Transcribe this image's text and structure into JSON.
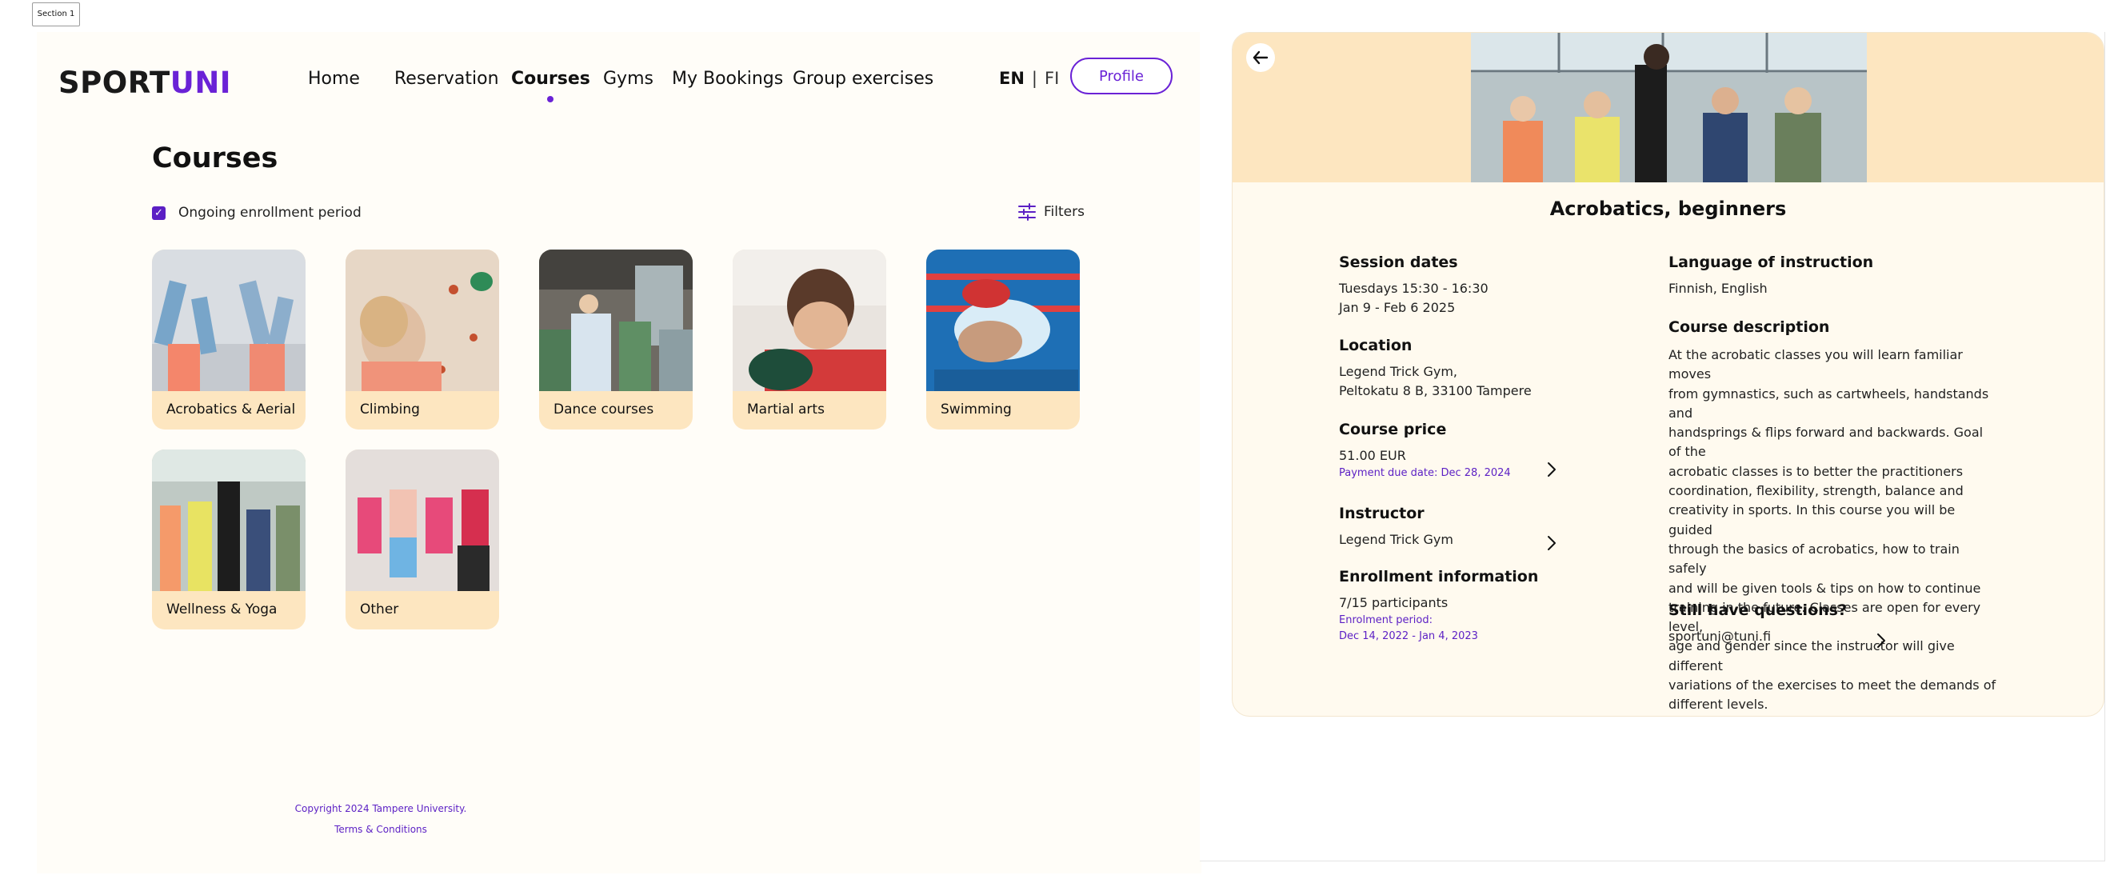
{
  "section_tag": "Section 1",
  "brand": {
    "part1": "SPORT",
    "part2": "UNI",
    "accent": "#6a22d6"
  },
  "nav": {
    "items": [
      "Home",
      "Reservation",
      "Courses",
      "Gyms",
      "My Bookings",
      "Group exercises"
    ],
    "active": "Courses"
  },
  "lang": {
    "en": "EN",
    "sep": "|",
    "fi": "FI"
  },
  "profile_label": "Profile",
  "page_title": "Courses",
  "enrollment_filter": {
    "label": "Ongoing enrollment period",
    "checked": true
  },
  "filters_label": "Filters",
  "categories": [
    "Acrobatics & Aerial",
    "Climbing",
    "Dance courses",
    "Martial arts",
    "Swimming",
    "Wellness & Yoga",
    "Other"
  ],
  "footer": {
    "copyright": "Copyright 2024 Tampere University.",
    "terms": "Terms & Conditions"
  },
  "course": {
    "title": "Acrobatics, beginners",
    "session": {
      "heading": "Session dates",
      "time": "Tuesdays 15:30 - 16:30",
      "dates": "Jan 9 - Feb 6 2025"
    },
    "location": {
      "heading": "Location",
      "line1": "Legend Trick Gym,",
      "line2": "Peltokatu 8 B, 33100 Tampere"
    },
    "price": {
      "heading": "Course price",
      "amount": "51.00 EUR",
      "due": "Payment due date: Dec 28, 2024"
    },
    "instructor": {
      "heading": "Instructor",
      "name": "Legend Trick Gym"
    },
    "enrollment": {
      "heading": "Enrollment information",
      "participants": "7/15 participants",
      "period_label": "Enrolment period:",
      "period": "Dec 14, 2022 - Jan 4, 2023"
    },
    "language": {
      "heading": "Language of instruction",
      "value": "Finnish, English"
    },
    "description": {
      "heading": "Course description",
      "lines": [
        "At the acrobatic classes you will learn familiar moves",
        "from gymnastics, such as cartwheels, handstands and",
        "handsprings & flips forward and backwards. Goal of the",
        "acrobatic classes is to better the practitioners",
        "coordination, flexibility, strength, balance and",
        "creativity in sports. In this course you will be guided",
        "through the basics of acrobatics, how to train safely",
        "and will be given tools & tips on how to continue",
        "training in the future. Classes are open for every level,",
        "age and gender since the instructor will give different",
        "variations of the exercises to meet the demands of",
        "different levels."
      ]
    },
    "questions": {
      "heading": "Still have questions?",
      "email": "sportuni@tuni.fi"
    }
  },
  "icons": {
    "checkbox": "check-icon",
    "filters": "sliders-icon",
    "back": "arrow-left-icon",
    "chevron": "chevron-right-icon"
  }
}
